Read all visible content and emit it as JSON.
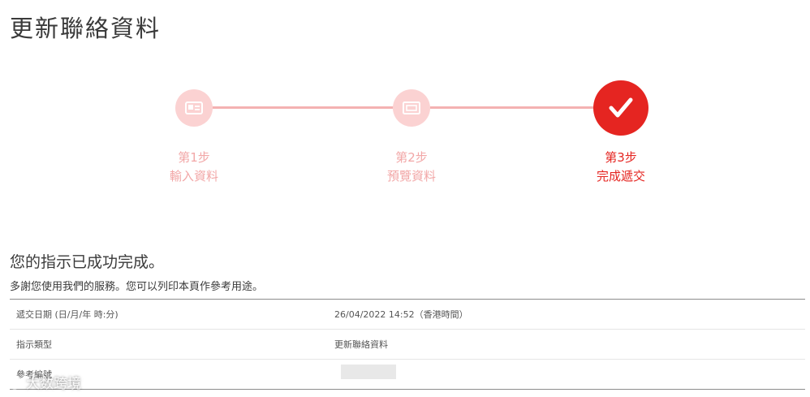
{
  "page": {
    "title": "更新聯絡資料"
  },
  "stepper": {
    "steps": [
      {
        "number": "第1步",
        "label": "輸入資料"
      },
      {
        "number": "第2步",
        "label": "預覽資料"
      },
      {
        "number": "第3步",
        "label": "完成遞交"
      }
    ]
  },
  "result": {
    "title": "您的指示已成功完成。",
    "description": "多謝您使用我們的服務。您可以列印本頁作參考用途。"
  },
  "details": {
    "rows": [
      {
        "label": "遞交日期 (日/月/年 時:分)",
        "value": "26/04/2022 14:52（香港時間）"
      },
      {
        "label": "指示類型",
        "value": "更新聯絡資料"
      },
      {
        "label": "參考編號",
        "value": ""
      }
    ]
  },
  "watermark": {
    "text": "大数跨境"
  },
  "colors": {
    "accent": "#e52521",
    "accent_light": "#fbd2d2",
    "line": "#f4b2b2"
  },
  "icons": {
    "step1": "id-card-icon",
    "step2": "preview-icon",
    "step3": "checkmark-icon"
  }
}
